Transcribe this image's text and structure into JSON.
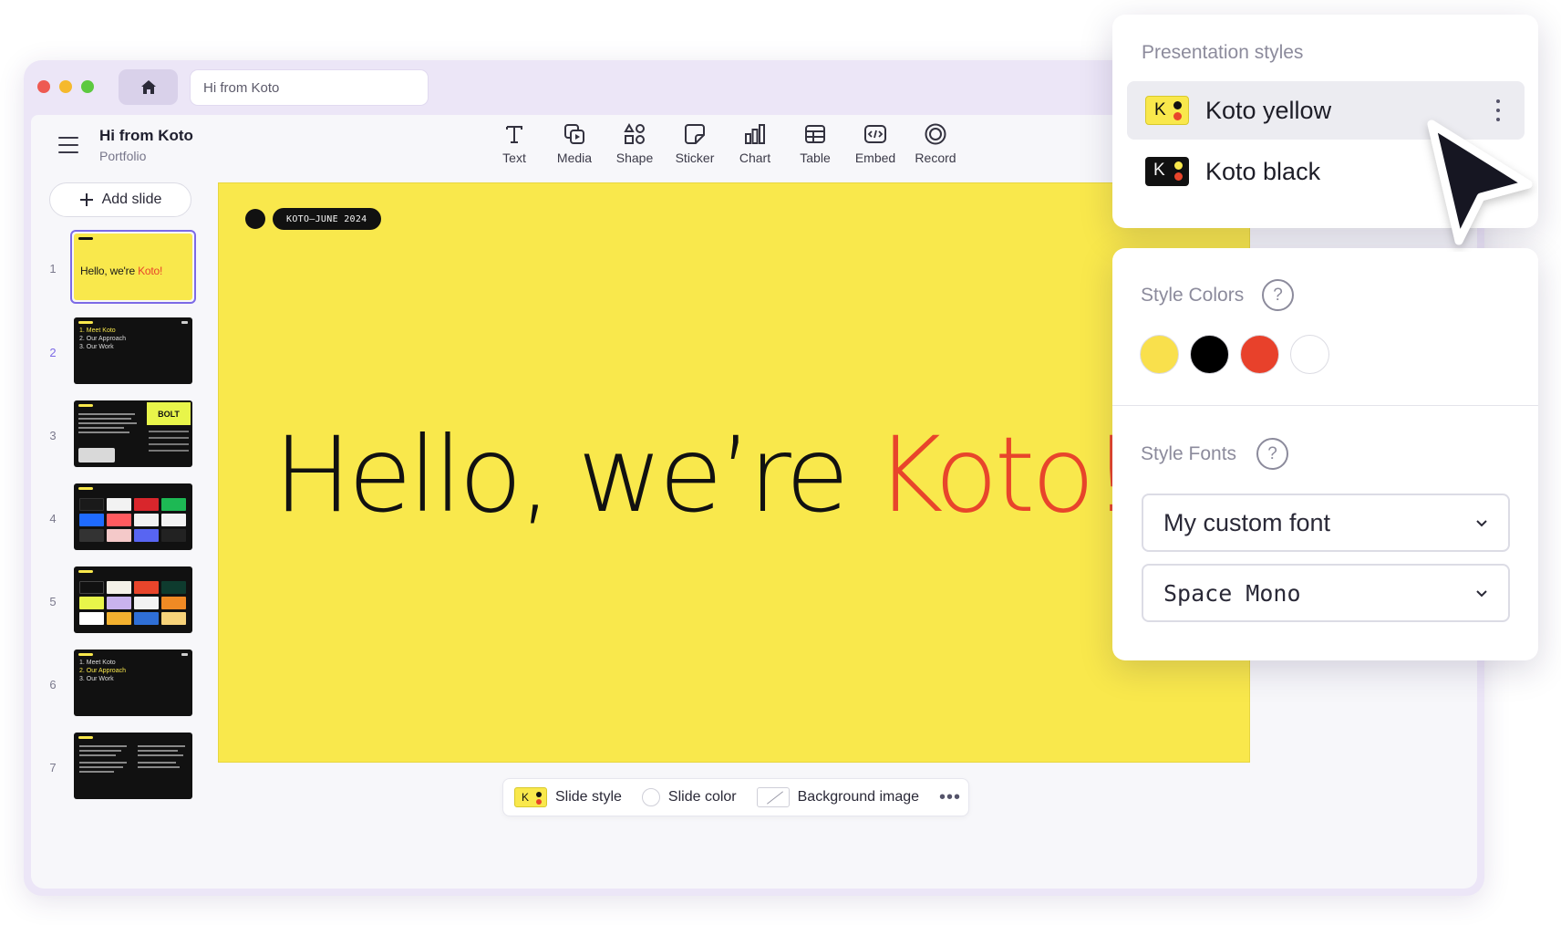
{
  "window": {
    "url_text": "Hi from Koto"
  },
  "header": {
    "title": "Hi from Koto",
    "subtitle": "Portfolio"
  },
  "toolbar": {
    "items": [
      {
        "label": "Text",
        "icon": "text-icon"
      },
      {
        "label": "Media",
        "icon": "media-icon"
      },
      {
        "label": "Shape",
        "icon": "shape-icon"
      },
      {
        "label": "Sticker",
        "icon": "sticker-icon"
      },
      {
        "label": "Chart",
        "icon": "chart-icon"
      },
      {
        "label": "Table",
        "icon": "table-icon"
      },
      {
        "label": "Embed",
        "icon": "embed-icon"
      },
      {
        "label": "Record",
        "icon": "record-icon"
      }
    ]
  },
  "sidebar": {
    "add_slide_label": "Add slide",
    "slides": [
      {
        "number": "1",
        "title_main": "Hello, we're ",
        "title_accent": "Koto!",
        "selected": true
      },
      {
        "number": "2",
        "lines": [
          "1. Meet Koto",
          "2. Our Approach",
          "3. Our Work"
        ]
      },
      {
        "number": "3",
        "badge": "BOLT"
      },
      {
        "number": "4"
      },
      {
        "number": "5"
      },
      {
        "number": "6",
        "lines": [
          "1. Meet Koto",
          "2. Our Approach",
          "3. Our Work"
        ]
      },
      {
        "number": "7"
      }
    ]
  },
  "canvas": {
    "tag": "KOTO—JUNE 2024",
    "headline_main": "Hello, we’re ",
    "headline_accent": "Koto!",
    "background": "#f9e84c",
    "accent_color": "#e8452b"
  },
  "bottom_bar": {
    "slide_style_label": "Slide style",
    "slide_color_label": "Slide color",
    "background_image_label": "Background image",
    "more_icon": "more-horizontal-icon"
  },
  "styles_panel": {
    "heading": "Presentation styles",
    "styles": [
      {
        "name": "Koto yellow",
        "selected": true
      },
      {
        "name": "Koto black",
        "selected": false
      }
    ]
  },
  "props_panel": {
    "colors_label": "Style Colors",
    "fonts_label": "Style Fonts",
    "help_glyph": "?",
    "colors": [
      "#f9e04c",
      "#000000",
      "#e8412b",
      "#ffffff"
    ],
    "fonts": [
      "My custom font",
      "Space Mono"
    ]
  }
}
